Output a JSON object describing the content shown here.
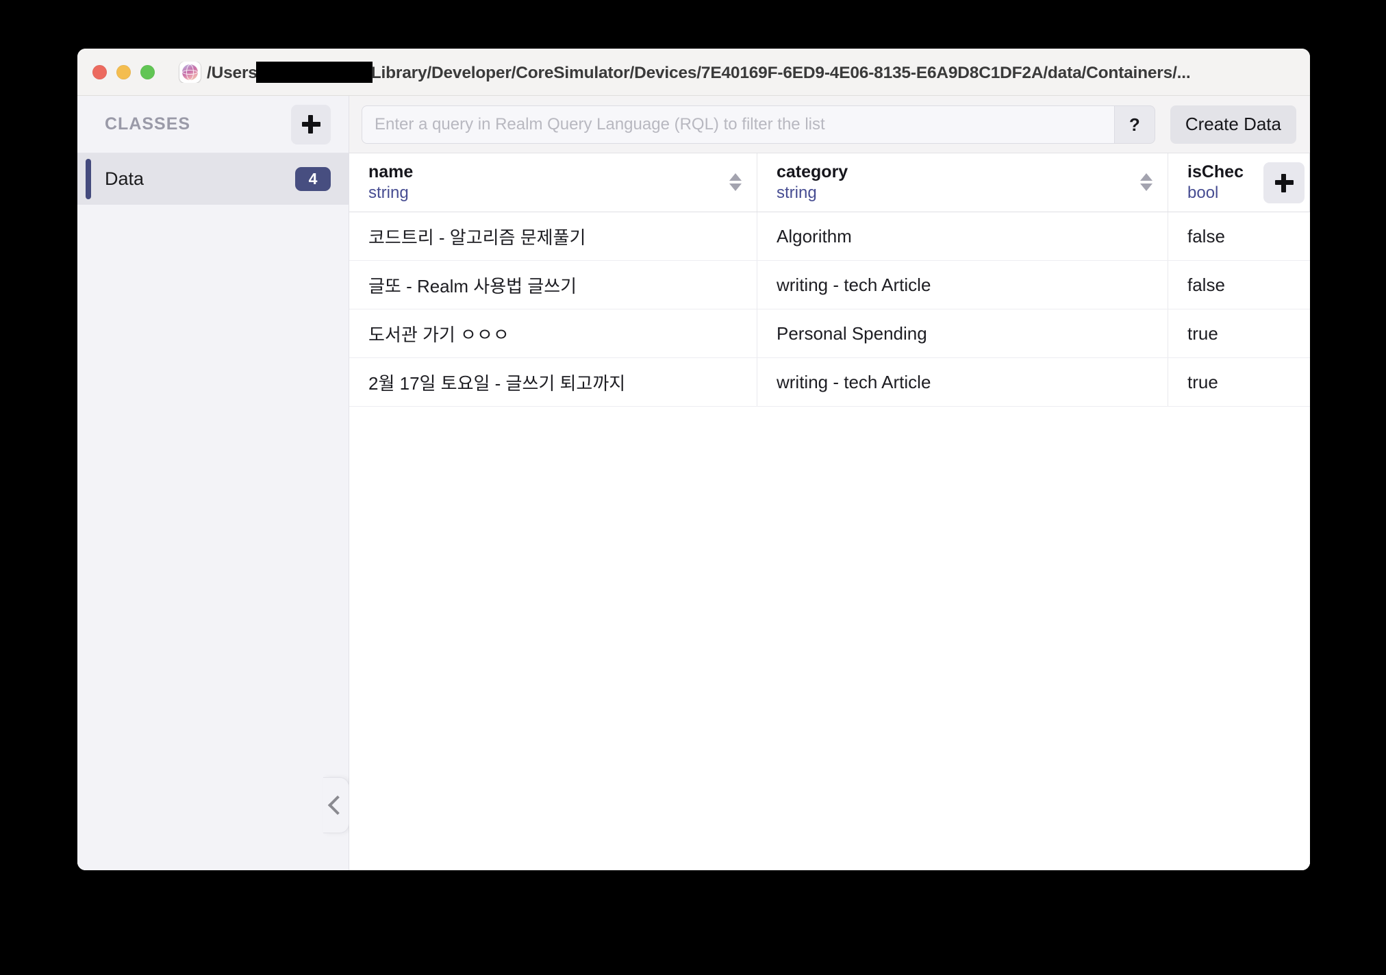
{
  "window": {
    "title_prefix": "/Users",
    "title_suffix": "Library/Developer/CoreSimulator/Devices/7E40169F-6ED9-4E06-8135-E6A9D8C1DF2A/data/Containers/...",
    "app_icon": "realm-studio-icon",
    "traffic_lights": [
      "close",
      "minimize",
      "maximize"
    ]
  },
  "sidebar": {
    "header_title": "CLASSES",
    "add_class_button": "+",
    "collapse_button": "<",
    "classes": [
      {
        "name": "Data",
        "count": "4",
        "selected": true
      }
    ]
  },
  "toolbar": {
    "query_value": "",
    "query_placeholder": "Enter a query in Realm Query Language (RQL) to filter the list",
    "help_label": "?",
    "create_label": "Create Data",
    "add_property_label": "+"
  },
  "table": {
    "columns": [
      {
        "name": "name",
        "type": "string",
        "sortable": true
      },
      {
        "name": "category",
        "type": "string",
        "sortable": true
      },
      {
        "name": "isChec",
        "type": "bool",
        "sortable": false
      }
    ],
    "rows": [
      {
        "name": "코드트리 - 알고리즘 문제풀기",
        "category": "Algorithm",
        "isChecked": "false"
      },
      {
        "name": "글또 - Realm 사용법 글쓰기",
        "category": "writing - tech Article",
        "isChecked": "false"
      },
      {
        "name": "도서관 가기 ㅇㅇㅇ",
        "category": "Personal Spending",
        "isChecked": "true"
      },
      {
        "name": "2월 17일 토요일 - 글쓰기 퇴고까지",
        "category": "writing - tech Article",
        "isChecked": "true"
      }
    ]
  },
  "colors": {
    "accent": "#474e80",
    "type_text": "#474d92",
    "sidebar_bg": "#f3f3f7",
    "titlebar_bg": "#f4f3f2"
  }
}
